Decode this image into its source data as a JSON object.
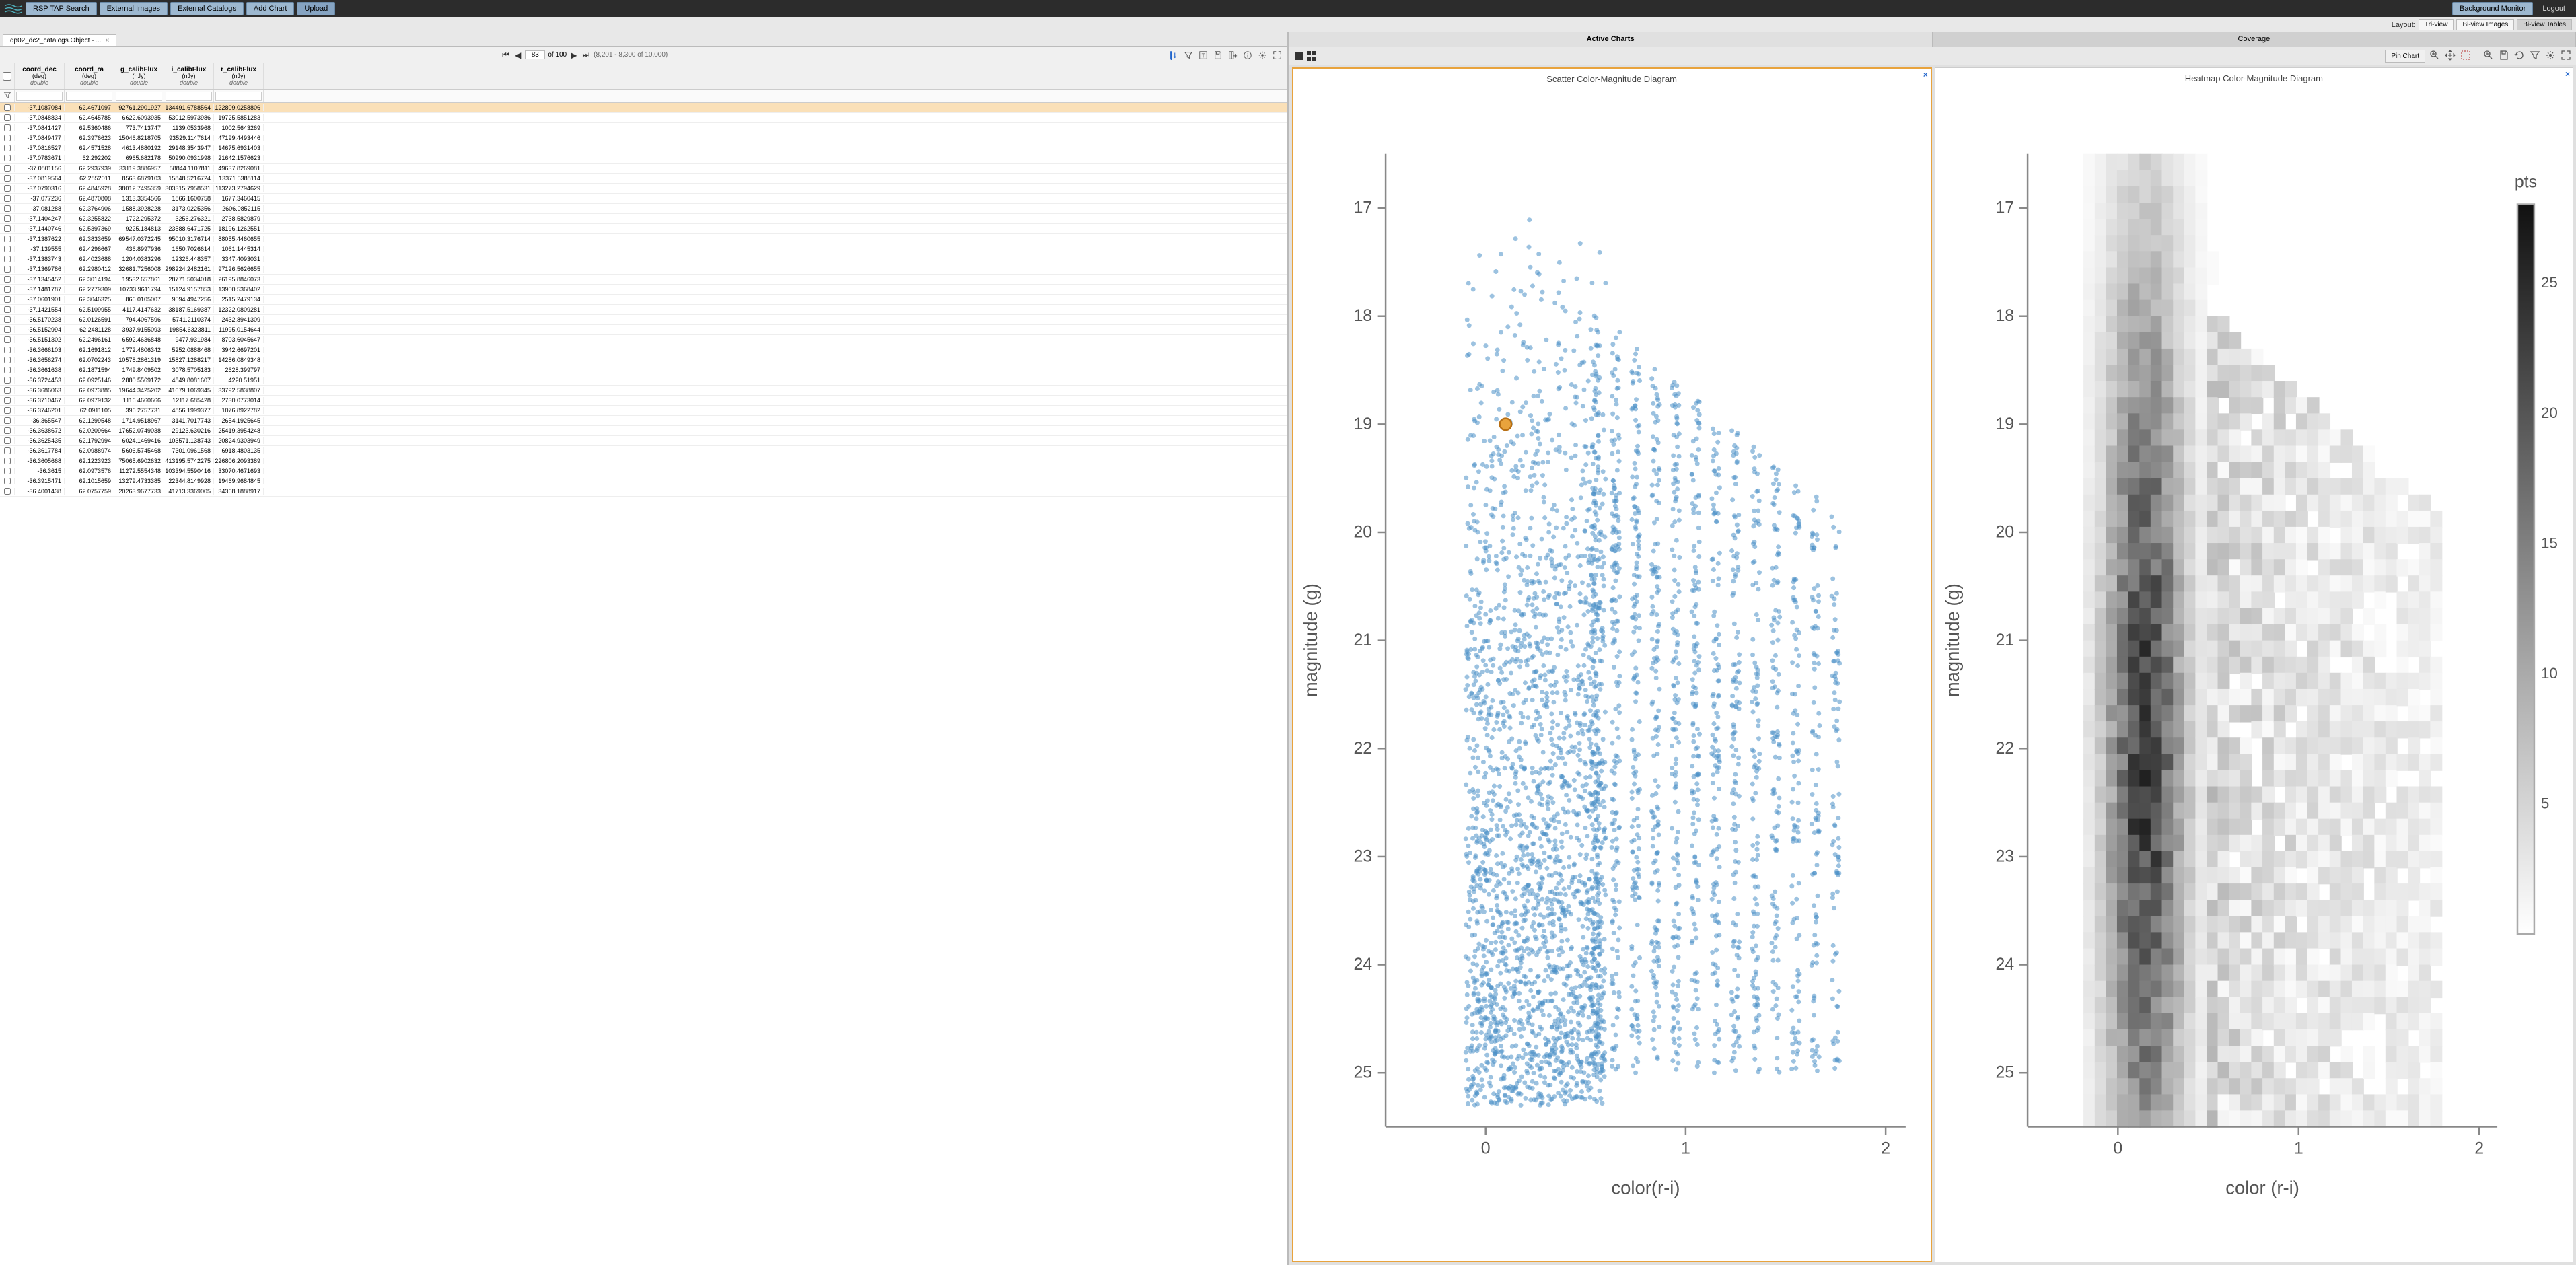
{
  "topbar": {
    "tap_search": "RSP TAP Search",
    "ext_images": "External Images",
    "ext_catalogs": "External Catalogs",
    "add_chart": "Add Chart",
    "upload": "Upload",
    "bgmon": "Background Monitor",
    "logout": "Logout"
  },
  "layoutbar": {
    "label": "Layout:",
    "triview": "Tri-view",
    "biimages": "Bi-view Images",
    "bitables": "Bi-view Tables"
  },
  "tabletab": {
    "label": "dp02_dc2_catalogs.Object - ..."
  },
  "pager": {
    "page": "83",
    "of": "of 100",
    "range": "(8,201 - 8,300 of 10,000)"
  },
  "columns": [
    {
      "name": "coord_dec",
      "unit": "(deg)",
      "type": "double"
    },
    {
      "name": "coord_ra",
      "unit": "(deg)",
      "type": "double"
    },
    {
      "name": "g_calibFlux",
      "unit": "(nJy)",
      "type": "double"
    },
    {
      "name": "i_calibFlux",
      "unit": "(nJy)",
      "type": "double"
    },
    {
      "name": "r_calibFlux",
      "unit": "(nJy)",
      "type": "double"
    }
  ],
  "rows": [
    [
      "-37.1087084",
      "62.4671097",
      "92761.2901927",
      "134491.6788564",
      "122809.0258806"
    ],
    [
      "-37.0848834",
      "62.4645785",
      "6622.6093935",
      "53012.5973986",
      "19725.5851283"
    ],
    [
      "-37.0841427",
      "62.5360486",
      "773.7413747",
      "1139.0533968",
      "1002.5643269"
    ],
    [
      "-37.0849477",
      "62.3976623",
      "15046.8218705",
      "93529.1147614",
      "47199.4493446"
    ],
    [
      "-37.0816527",
      "62.4571528",
      "4613.4880192",
      "29148.3543947",
      "14675.6931403"
    ],
    [
      "-37.0783671",
      "62.292202",
      "6965.682178",
      "50990.0931998",
      "21642.1576623"
    ],
    [
      "-37.0801156",
      "62.2937939",
      "33119.3886957",
      "58844.1107811",
      "49637.8269081"
    ],
    [
      "-37.0819564",
      "62.2852011",
      "8563.6879103",
      "15848.5216724",
      "13371.5388114"
    ],
    [
      "-37.0790316",
      "62.4845928",
      "38012.7495359",
      "303315.7958531",
      "113273.2794629"
    ],
    [
      "-37.077236",
      "62.4870808",
      "1313.3354566",
      "1866.1600758",
      "1677.3460415"
    ],
    [
      "-37.081288",
      "62.3764906",
      "1588.3928228",
      "3173.0225356",
      "2606.0852115"
    ],
    [
      "-37.1404247",
      "62.3255822",
      "1722.295372",
      "3256.276321",
      "2738.5829879"
    ],
    [
      "-37.1440746",
      "62.5397369",
      "9225.184813",
      "23588.6471725",
      "18196.1262551"
    ],
    [
      "-37.1387622",
      "62.3833659",
      "69547.0372245",
      "95010.3176714",
      "88055.4460655"
    ],
    [
      "-37.139555",
      "62.4296667",
      "436.8997936",
      "1650.7026614",
      "1061.1445314"
    ],
    [
      "-37.1383743",
      "62.4023688",
      "1204.0383296",
      "12326.448357",
      "3347.4093031"
    ],
    [
      "-37.1369786",
      "62.2980412",
      "32681.7256008",
      "298224.2482161",
      "97126.5626655"
    ],
    [
      "-37.1345452",
      "62.3014194",
      "19532.657861",
      "28771.5034018",
      "26195.8846073"
    ],
    [
      "-37.1481787",
      "62.2779309",
      "10733.9611794",
      "15124.9157853",
      "13900.5368402"
    ],
    [
      "-37.0601901",
      "62.3046325",
      "866.0105007",
      "9094.4947256",
      "2515.2479134"
    ],
    [
      "-37.1421554",
      "62.5109955",
      "4117.4147632",
      "38187.5169387",
      "12322.0809281"
    ],
    [
      "-36.5170238",
      "62.0126591",
      "794.4067596",
      "5741.2110374",
      "2432.8941309"
    ],
    [
      "-36.5152994",
      "62.2481128",
      "3937.9155093",
      "19854.6323811",
      "11995.0154644"
    ],
    [
      "-36.5151302",
      "62.2496161",
      "6592.4636848",
      "9477.931984",
      "8703.6045647"
    ],
    [
      "-36.3666103",
      "62.1691812",
      "1772.4806342",
      "5252.0888468",
      "3942.6697201"
    ],
    [
      "-36.3656274",
      "62.0702243",
      "10578.2861319",
      "15827.1288217",
      "14286.0849348"
    ],
    [
      "-36.3661638",
      "62.1871594",
      "1749.8409502",
      "3078.5705183",
      "2628.399797"
    ],
    [
      "-36.3724453",
      "62.0925146",
      "2880.5569172",
      "4849.8081607",
      "4220.51951"
    ],
    [
      "-36.3686063",
      "62.0973885",
      "19644.3425202",
      "41679.1069345",
      "33792.5838807"
    ],
    [
      "-36.3710467",
      "62.0979132",
      "1116.4660666",
      "12117.685428",
      "2730.0773014"
    ],
    [
      "-36.3746201",
      "62.0911105",
      "396.2757731",
      "4856.1999377",
      "1076.8922782"
    ],
    [
      "-36.365547",
      "62.1299548",
      "1714.9518967",
      "3141.7017743",
      "2654.1925645"
    ],
    [
      "-36.3638672",
      "62.0209664",
      "17652.0749038",
      "29123.630216",
      "25419.3954248"
    ],
    [
      "-36.3625435",
      "62.1792994",
      "6024.1469416",
      "103571.138743",
      "20824.9303949"
    ],
    [
      "-36.3617784",
      "62.0988974",
      "5606.5745468",
      "7301.0961568",
      "6918.4803135"
    ],
    [
      "-36.3605668",
      "62.1223923",
      "75065.6902632",
      "413195.5742275",
      "226806.2093389"
    ],
    [
      "-36.3615",
      "62.0973576",
      "11272.5554348",
      "103394.5590416",
      "33070.4671693"
    ],
    [
      "-36.3915471",
      "62.1015659",
      "13279.4733385",
      "22344.8149928",
      "19469.9684845"
    ],
    [
      "-36.4001438",
      "62.0757759",
      "20263.9677733",
      "41713.3369005",
      "34368.1888917"
    ]
  ],
  "charttabs": {
    "active": "Active Charts",
    "coverage": "Coverage"
  },
  "pinlabel": "Pin Chart",
  "chart1": {
    "title": "Scatter Color-Magnitude Diagram",
    "xlabel": "color(r-i)",
    "ylabel": "magnitude (g)"
  },
  "chart2": {
    "title": "Heatmap Color-Magnitude Diagram",
    "xlabel": "color (r-i)",
    "ylabel": "magnitude (g)",
    "cbar": "pts"
  },
  "chart_data": [
    {
      "type": "scatter",
      "title": "Scatter Color-Magnitude Diagram",
      "xlabel": "color(r-i)",
      "ylabel": "magnitude (g)",
      "xlim": [
        -0.5,
        2.1
      ],
      "ylim": [
        25.5,
        16.5
      ],
      "xticks": [
        0,
        1,
        2
      ],
      "yticks": [
        17,
        18,
        19,
        20,
        21,
        22,
        23,
        24,
        25
      ],
      "highlighted_point": {
        "x": 0.1,
        "y": 19.0
      },
      "note": "dense scatter of ~8000 pts, vertical striations, concentrated x=0..0.5"
    },
    {
      "type": "heatmap",
      "title": "Heatmap Color-Magnitude Diagram",
      "xlabel": "color (r-i)",
      "ylabel": "magnitude (g)",
      "xlim": [
        -0.5,
        2.1
      ],
      "ylim": [
        25.5,
        16.5
      ],
      "xticks": [
        0,
        1,
        2
      ],
      "yticks": [
        17,
        18,
        19,
        20,
        21,
        22,
        23,
        24,
        25
      ],
      "colorbar": {
        "label": "pts",
        "ticks": [
          5,
          10,
          15,
          20,
          25
        ]
      }
    }
  ]
}
